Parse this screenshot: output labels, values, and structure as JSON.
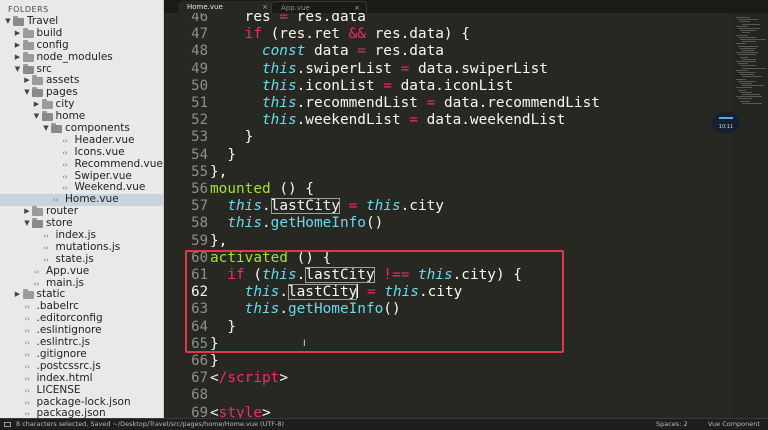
{
  "sidebar": {
    "title": "FOLDERS",
    "items": [
      {
        "label": "Travel",
        "depth": 0,
        "kind": "folder",
        "expanded": true
      },
      {
        "label": "build",
        "depth": 1,
        "kind": "folder",
        "expanded": false
      },
      {
        "label": "config",
        "depth": 1,
        "kind": "folder",
        "expanded": false
      },
      {
        "label": "node_modules",
        "depth": 1,
        "kind": "folder",
        "expanded": false
      },
      {
        "label": "src",
        "depth": 1,
        "kind": "folder",
        "expanded": true
      },
      {
        "label": "assets",
        "depth": 2,
        "kind": "folder",
        "expanded": false
      },
      {
        "label": "pages",
        "depth": 2,
        "kind": "folder",
        "expanded": true
      },
      {
        "label": "city",
        "depth": 3,
        "kind": "folder",
        "expanded": false
      },
      {
        "label": "home",
        "depth": 3,
        "kind": "folder",
        "expanded": true
      },
      {
        "label": "components",
        "depth": 4,
        "kind": "folder",
        "expanded": true
      },
      {
        "label": "Header.vue",
        "depth": 5,
        "kind": "file"
      },
      {
        "label": "Icons.vue",
        "depth": 5,
        "kind": "file"
      },
      {
        "label": "Recommend.vue",
        "depth": 5,
        "kind": "file"
      },
      {
        "label": "Swiper.vue",
        "depth": 5,
        "kind": "file"
      },
      {
        "label": "Weekend.vue",
        "depth": 5,
        "kind": "file"
      },
      {
        "label": "Home.vue",
        "depth": 4,
        "kind": "file",
        "active": true
      },
      {
        "label": "router",
        "depth": 2,
        "kind": "folder",
        "expanded": false
      },
      {
        "label": "store",
        "depth": 2,
        "kind": "folder",
        "expanded": true
      },
      {
        "label": "index.js",
        "depth": 3,
        "kind": "file"
      },
      {
        "label": "mutations.js",
        "depth": 3,
        "kind": "file"
      },
      {
        "label": "state.js",
        "depth": 3,
        "kind": "file"
      },
      {
        "label": "App.vue",
        "depth": 2,
        "kind": "file"
      },
      {
        "label": "main.js",
        "depth": 2,
        "kind": "file"
      },
      {
        "label": "static",
        "depth": 1,
        "kind": "folder",
        "expanded": false
      },
      {
        "label": ".babelrc",
        "depth": 1,
        "kind": "file"
      },
      {
        "label": ".editorconfig",
        "depth": 1,
        "kind": "file"
      },
      {
        "label": ".eslintignore",
        "depth": 1,
        "kind": "file"
      },
      {
        "label": ".eslintrc.js",
        "depth": 1,
        "kind": "file"
      },
      {
        "label": ".gitignore",
        "depth": 1,
        "kind": "file"
      },
      {
        "label": ".postcssrc.js",
        "depth": 1,
        "kind": "file"
      },
      {
        "label": "index.html",
        "depth": 1,
        "kind": "file"
      },
      {
        "label": "LICENSE",
        "depth": 1,
        "kind": "file"
      },
      {
        "label": "package-lock.json",
        "depth": 1,
        "kind": "file"
      },
      {
        "label": "package.json",
        "depth": 1,
        "kind": "file"
      }
    ]
  },
  "tabs": [
    {
      "label": "Home.vue",
      "active": true,
      "close": "×"
    },
    {
      "label": "App.vue",
      "active": false,
      "close": "×"
    }
  ],
  "editor": {
    "current_line": 62,
    "lines": [
      {
        "n": 46,
        "t": [
          [
            "    ",
            ""
          ],
          [
            "res",
            ""
          ],
          [
            " = ",
            "kw"
          ],
          [
            "res.data",
            ""
          ]
        ]
      },
      {
        "n": 47,
        "t": [
          [
            "    ",
            ""
          ],
          [
            "if",
            "kw"
          ],
          [
            " (res.ret ",
            ""
          ],
          [
            "&&",
            "kw"
          ],
          [
            " res.data) {",
            ""
          ]
        ]
      },
      {
        "n": 48,
        "t": [
          [
            "      ",
            ""
          ],
          [
            "const",
            "it"
          ],
          [
            " data ",
            ""
          ],
          [
            "=",
            "kw"
          ],
          [
            " res.data",
            ""
          ]
        ]
      },
      {
        "n": 49,
        "t": [
          [
            "      ",
            ""
          ],
          [
            "this",
            "it"
          ],
          [
            ".swiperList ",
            ""
          ],
          [
            "=",
            "kw"
          ],
          [
            " data.swiperList",
            ""
          ]
        ]
      },
      {
        "n": 50,
        "t": [
          [
            "      ",
            ""
          ],
          [
            "this",
            "it"
          ],
          [
            ".iconList ",
            ""
          ],
          [
            "=",
            "kw"
          ],
          [
            " data.iconList",
            ""
          ]
        ]
      },
      {
        "n": 51,
        "t": [
          [
            "      ",
            ""
          ],
          [
            "this",
            "it"
          ],
          [
            ".recommendList ",
            ""
          ],
          [
            "=",
            "kw"
          ],
          [
            " data.recommendList",
            ""
          ]
        ]
      },
      {
        "n": 52,
        "t": [
          [
            "      ",
            ""
          ],
          [
            "this",
            "it"
          ],
          [
            ".weekendList ",
            ""
          ],
          [
            "=",
            "kw"
          ],
          [
            " data.weekendList",
            ""
          ]
        ]
      },
      {
        "n": 53,
        "t": [
          [
            "    }",
            ""
          ]
        ]
      },
      {
        "n": 54,
        "t": [
          [
            "  }",
            ""
          ]
        ]
      },
      {
        "n": 55,
        "t": [
          [
            "},",
            ""
          ]
        ]
      },
      {
        "n": 56,
        "t": [
          [
            "mounted",
            "fn"
          ],
          [
            " () {",
            ""
          ]
        ]
      },
      {
        "n": 57,
        "t": [
          [
            "  ",
            ""
          ],
          [
            "this",
            "it"
          ],
          [
            ".",
            ""
          ],
          [
            "lastCity",
            "sel"
          ],
          [
            " ",
            ""
          ],
          [
            "=",
            "kw"
          ],
          [
            " ",
            ""
          ],
          [
            "this",
            "it"
          ],
          [
            ".city",
            ""
          ]
        ]
      },
      {
        "n": 58,
        "t": [
          [
            "  ",
            ""
          ],
          [
            "this",
            "it"
          ],
          [
            ".",
            ""
          ],
          [
            "getHomeInfo",
            "fc"
          ],
          [
            "()",
            ""
          ]
        ]
      },
      {
        "n": 59,
        "t": [
          [
            "},",
            ""
          ]
        ]
      },
      {
        "n": 60,
        "t": [
          [
            "activated",
            "fn"
          ],
          [
            " () {",
            ""
          ]
        ]
      },
      {
        "n": 61,
        "t": [
          [
            "  ",
            ""
          ],
          [
            "if",
            "kw"
          ],
          [
            " (",
            ""
          ],
          [
            "this",
            "it"
          ],
          [
            ".",
            ""
          ],
          [
            "lastCity",
            "sel"
          ],
          [
            " ",
            ""
          ],
          [
            "!==",
            "kw"
          ],
          [
            " ",
            ""
          ],
          [
            "this",
            "it"
          ],
          [
            ".city) {",
            ""
          ]
        ]
      },
      {
        "n": 62,
        "t": [
          [
            "    ",
            ""
          ],
          [
            "this",
            "it"
          ],
          [
            ".",
            ""
          ],
          [
            "lastCity",
            "sel"
          ],
          [
            "|",
            "cursor"
          ],
          [
            " ",
            ""
          ],
          [
            "=",
            "kw"
          ],
          [
            " ",
            ""
          ],
          [
            "this",
            "it"
          ],
          [
            ".city",
            ""
          ]
        ]
      },
      {
        "n": 63,
        "t": [
          [
            "    ",
            ""
          ],
          [
            "this",
            "it"
          ],
          [
            ".",
            ""
          ],
          [
            "getHomeInfo",
            "fc"
          ],
          [
            "()",
            ""
          ]
        ]
      },
      {
        "n": 64,
        "t": [
          [
            "  }",
            ""
          ]
        ]
      },
      {
        "n": 65,
        "t": [
          [
            "}",
            ""
          ]
        ]
      },
      {
        "n": 66,
        "t": [
          [
            "}",
            ""
          ]
        ]
      },
      {
        "n": 67,
        "t": [
          [
            "<",
            ""
          ],
          [
            "/script",
            "kw"
          ],
          [
            ">",
            ""
          ]
        ]
      },
      {
        "n": 68,
        "t": [
          [
            "",
            ""
          ]
        ]
      },
      {
        "n": 69,
        "t": [
          [
            "<",
            ""
          ],
          [
            "style",
            "kw"
          ],
          [
            ">",
            ""
          ]
        ]
      }
    ]
  },
  "minimap_badge": "10:11",
  "status": {
    "left": "8 characters selected, Saved ~/Desktop/Travel/src/pages/home/Home.vue (UTF-8)",
    "spaces": "Spaces: 2",
    "syntax": "Vue Component"
  },
  "colors": {
    "editor_bg": "#272822",
    "keyword": "#f92672",
    "storage": "#66d9ef",
    "function": "#a6e22e",
    "highlight_box": "#e03a4a"
  }
}
